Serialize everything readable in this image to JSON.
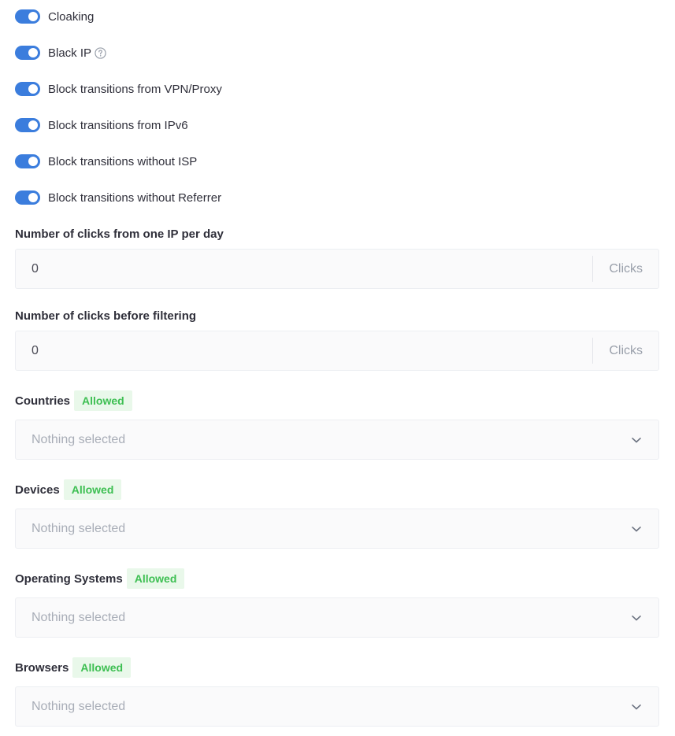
{
  "toggles": [
    {
      "label": "Cloaking",
      "on": true,
      "help": false
    },
    {
      "label": "Black IP",
      "on": true,
      "help": true
    },
    {
      "label": "Block transitions from VPN/Proxy",
      "on": true,
      "help": false
    },
    {
      "label": "Block transitions from IPv6",
      "on": true,
      "help": false
    },
    {
      "label": "Block transitions without ISP",
      "on": true,
      "help": false
    },
    {
      "label": "Block transitions without Referrer",
      "on": true,
      "help": false
    }
  ],
  "clicks_per_ip": {
    "label": "Number of clicks from one IP per day",
    "value": "0",
    "suffix": "Clicks"
  },
  "clicks_before_filtering": {
    "label": "Number of clicks before filtering",
    "value": "0",
    "suffix": "Clicks"
  },
  "filters": [
    {
      "label": "Countries",
      "badge": "Allowed",
      "placeholder": "Nothing selected"
    },
    {
      "label": "Devices",
      "badge": "Allowed",
      "placeholder": "Nothing selected"
    },
    {
      "label": "Operating Systems",
      "badge": "Allowed",
      "placeholder": "Nothing selected"
    },
    {
      "label": "Browsers",
      "badge": "Allowed",
      "placeholder": "Nothing selected"
    }
  ],
  "colors": {
    "toggle_on": "#3b7ddd",
    "badge_bg": "#e9f8ea",
    "badge_text": "#3dbf52"
  }
}
